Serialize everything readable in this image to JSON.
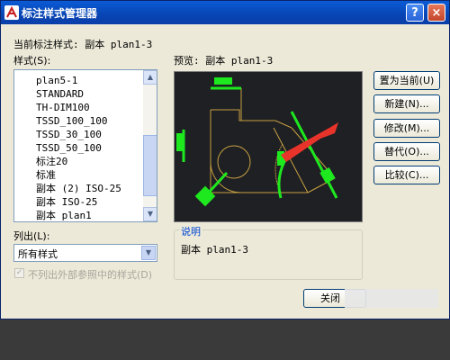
{
  "window": {
    "title": "标注样式管理器",
    "help_glyph": "?",
    "close_glyph": "×"
  },
  "current_style": {
    "label": "当前标注样式: 副本 plan1-3"
  },
  "styles": {
    "label": "样式(S):",
    "items": [
      "plan5-1",
      "STANDARD",
      "TH-DIM100",
      "TSSD_100_100",
      "TSSD_30_100",
      "TSSD_50_100",
      "标注20",
      "标准",
      "副本 (2) ISO-25",
      "副本 ISO-25",
      "副本 plan1"
    ]
  },
  "list_filter": {
    "label": "列出(L):",
    "value": "所有样式"
  },
  "xref_checkbox": {
    "label": "不列出外部参照中的样式(D)",
    "checked": true
  },
  "preview": {
    "label": "预览: 副本 plan1-3"
  },
  "description": {
    "title": "说明",
    "text": "副本 plan1-3"
  },
  "buttons": {
    "set_current": "置为当前(U)",
    "new": "新建(N)...",
    "modify": "修改(M)...",
    "override": "替代(O)...",
    "compare": "比较(C)...",
    "close": "关闭"
  },
  "colors": {
    "titlebar": "#0846b6",
    "preview_bg": "#1e2024",
    "dim_line": "#c8a040",
    "dim_text": "#1ee81e",
    "arrow": "#e8332a"
  }
}
